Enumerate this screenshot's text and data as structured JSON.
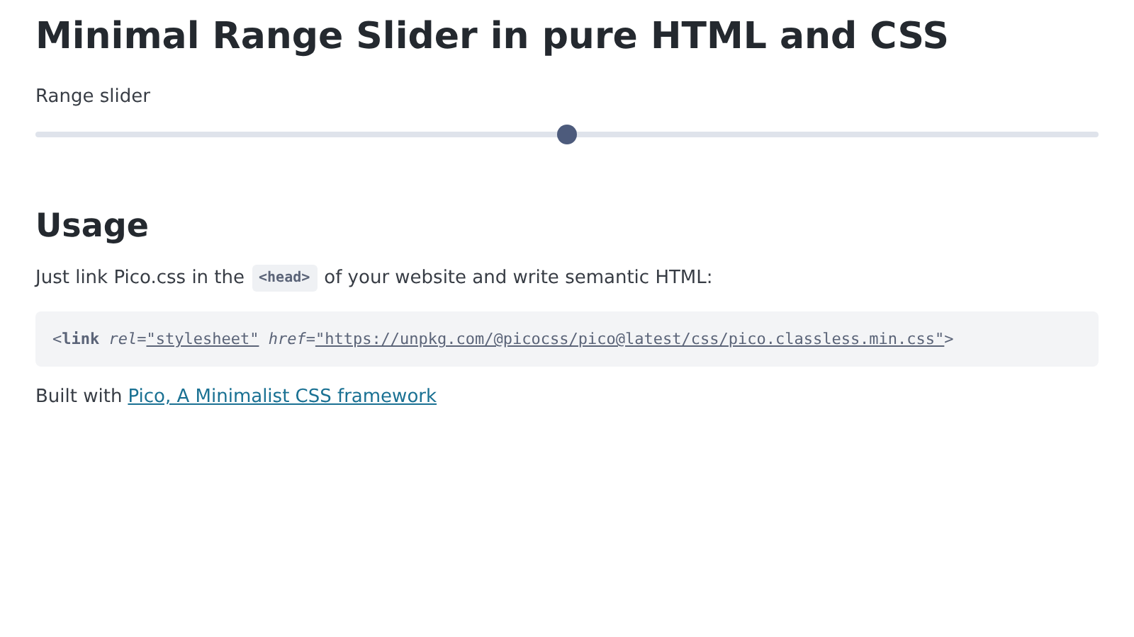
{
  "title": "Minimal Range Slider in pure HTML and CSS",
  "slider": {
    "label": "Range slider",
    "level": 0.5
  },
  "usage": {
    "heading": "Usage",
    "intro": {
      "before": "Just link Pico.css in the",
      "code": "<head>",
      "after": "of your website and write semantic HTML:"
    },
    "code_tokens": [
      {
        "kind": "punct",
        "text": "<"
      },
      {
        "kind": "tag",
        "text": "link"
      },
      {
        "kind": "attr",
        "text": "rel"
      },
      {
        "kind": "punct",
        "text": "="
      },
      {
        "kind": "value",
        "text": "\"stylesheet\""
      },
      {
        "kind": "attr",
        "text": "href"
      },
      {
        "kind": "punct",
        "text": "="
      },
      {
        "kind": "value",
        "text": "\"https://unpkg.com/@picocss/pico@latest/css/pico.classless.min.css\""
      },
      {
        "kind": "punct",
        "text": ">"
      }
    ]
  },
  "footer": {
    "text": "Built with",
    "link": "Pico, A Minimalist CSS framework"
  }
}
